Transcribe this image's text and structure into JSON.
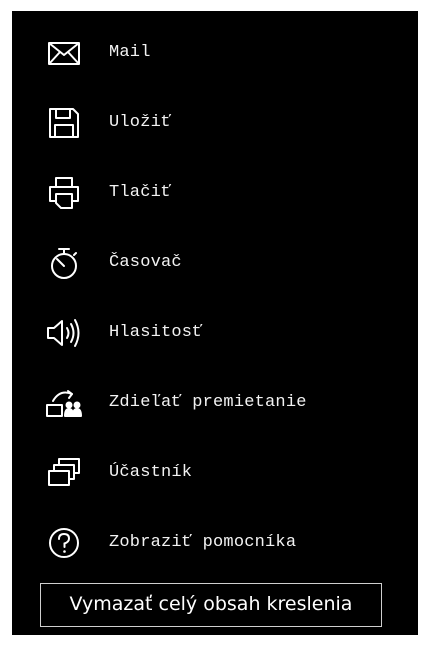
{
  "menu": {
    "items": [
      {
        "label": "Mail",
        "icon": "mail-icon"
      },
      {
        "label": "Uložiť",
        "icon": "save-icon"
      },
      {
        "label": "Tlačiť",
        "icon": "print-icon"
      },
      {
        "label": "Časovač",
        "icon": "timer-icon"
      },
      {
        "label": "Hlasitosť",
        "icon": "volume-icon"
      },
      {
        "label": "Zdieľať premietanie",
        "icon": "share-screen-icon"
      },
      {
        "label": "Účastník",
        "icon": "participant-icon"
      },
      {
        "label": "Zobraziť pomocníka",
        "icon": "help-icon"
      }
    ],
    "clear_button": "Vymazať celý obsah kreslenia"
  },
  "colors": {
    "background": "#000000",
    "text": "#f2f2f2",
    "border": "#cfcfcf"
  }
}
